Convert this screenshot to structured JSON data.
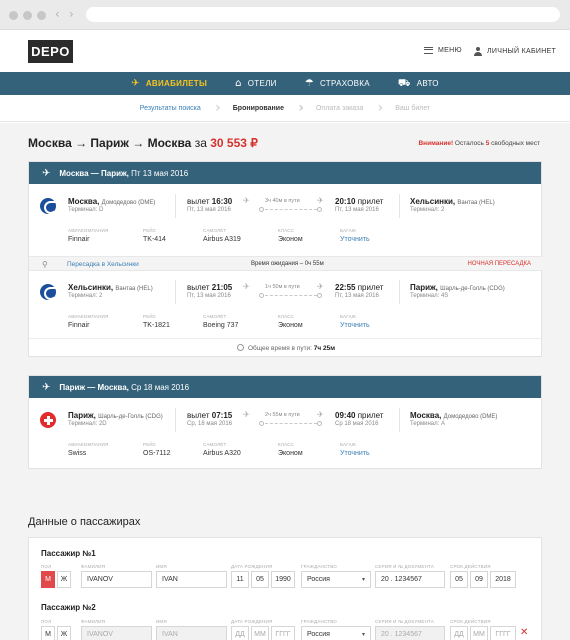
{
  "header": {
    "logo": "DEPO",
    "menu_label": "МЕНЮ",
    "cabinet_label": "ЛИЧНЫЙ КАБИНЕТ"
  },
  "nav": [
    {
      "label": "АВИАБИЛЕТЫ",
      "icon": "airplane-icon",
      "active": true
    },
    {
      "label": "ОТЕЛИ",
      "icon": "bed-icon",
      "active": false
    },
    {
      "label": "СТРАХОВКА",
      "icon": "umbrella-icon",
      "active": false
    },
    {
      "label": "АВТО",
      "icon": "car-icon",
      "active": false
    }
  ],
  "steps": [
    {
      "label": "Результаты поиска",
      "state": "done"
    },
    {
      "label": "Бронирование",
      "state": "current"
    },
    {
      "label": "Оплата заказа",
      "state": "todo"
    },
    {
      "label": "Ваш билет",
      "state": "todo"
    }
  ],
  "summary": {
    "route": "Москва → Париж → Москва",
    "for": "за",
    "price": "30 553 ₽",
    "alert_prefix": "Внимание!",
    "alert_text_1": "Осталось",
    "alert_count": "5",
    "alert_text_2": "свободных мест"
  },
  "labels": {
    "departure": "вылет",
    "arrival": "прилет",
    "airline": "АВИАКОМПАНИЯ",
    "flight": "РЕЙС",
    "aircraft": "САМОЛЁТ",
    "class": "КЛАСС",
    "baggage": "БАГАЖ",
    "in_flight": "в пути"
  },
  "outbound": {
    "title": "Москва — Париж,",
    "date": "Пт 13 мая 2016",
    "seg1": {
      "from_city": "Москва,",
      "from_airport": "Домодедово (DME)",
      "from_term": "Терминал: D",
      "dep_time": "16:30",
      "dep_date": "Пт, 13 мая 2016",
      "duration": "3ч 40м",
      "arr_time": "20:10",
      "arr_date": "Пт, 13 мая 2016",
      "to_city": "Хельсинки,",
      "to_airport": "Вантаа (HEL)",
      "to_term": "Терминал: 2",
      "airline": "Finnair",
      "flight": "TK-414",
      "aircraft": "Airbus A319",
      "class": "Эконом",
      "baggage": "Уточнить"
    },
    "transfer": {
      "text": "Пересадка в Хельсинки",
      "wait_label": "Время ожидания –",
      "wait": "0ч 55м",
      "night": "НОЧНАЯ ПЕРЕСАДКА"
    },
    "seg2": {
      "from_city": "Хельсинки,",
      "from_airport": "Вантаа (HEL)",
      "from_term": "Терминал: 2",
      "dep_time": "21:05",
      "dep_date": "Пт, 13 мая 2016",
      "duration": "1ч 50м",
      "arr_time": "22:55",
      "arr_date": "Пт, 13 мая 2016",
      "to_city": "Париж,",
      "to_airport": "Шарль-де-Голль (CDG)",
      "to_term": "Терминал: 4S",
      "airline": "Finnair",
      "flight": "TK-1821",
      "aircraft": "Boeing 737",
      "class": "Эконом",
      "baggage": "Уточнить"
    },
    "total_label": "Общее время в пути:",
    "total": "7ч 25м"
  },
  "return": {
    "title": "Париж — Москва,",
    "date": "Ср 18 мая 2016",
    "seg1": {
      "from_city": "Париж,",
      "from_airport": "Шарль-де-Голль (CDG)",
      "from_term": "Терминал: 2D",
      "dep_time": "07:15",
      "dep_date": "Ср, 18 мая 2016",
      "duration": "2ч 55м",
      "arr_time": "09:40",
      "arr_date": "Ср 18 мая 2016",
      "to_city": "Москва,",
      "to_airport": "Домодедово (DME)",
      "to_term": "Терминал: A",
      "airline": "Swiss",
      "flight": "OS-7112",
      "aircraft": "Airbus A320",
      "class": "Эконом",
      "baggage": "Уточнить"
    }
  },
  "passengers": {
    "title": "Данные о пассажирах",
    "field_labels": {
      "sex": "ПОЛ",
      "surname": "ФАМИЛИЯ",
      "name": "ИМЯ",
      "birth": "ДАТА РОЖДЕНИЯ",
      "citizenship": "ГРАЖДАНСТВО",
      "doc": "СЕРИЯ И № ДОКУМЕНТА",
      "validity": "СРОК ДЕЙСТВИЯ"
    },
    "sex_m": "М",
    "sex_f": "Ж",
    "items": [
      {
        "title": "Пассажир №1",
        "surname": "IVANOV",
        "name": "IVAN",
        "birth_d": "11",
        "birth_m": "05",
        "birth_y": "1990",
        "citizenship": "Россия",
        "doc": "20 . 1234567",
        "valid_d": "05",
        "valid_m": "09",
        "valid_y": "2018"
      },
      {
        "title": "Пассажир №2",
        "surname": "IVANOV",
        "name": "IVAN",
        "birth_d": "ДД",
        "birth_m": "ММ",
        "birth_y": "ГГГГ",
        "citizenship": "Россия",
        "doc": "20 . 1234567",
        "valid_d": "ДД",
        "valid_m": "ММ",
        "valid_y": "ГГГГ"
      }
    ],
    "remove_glyph": "✕"
  }
}
